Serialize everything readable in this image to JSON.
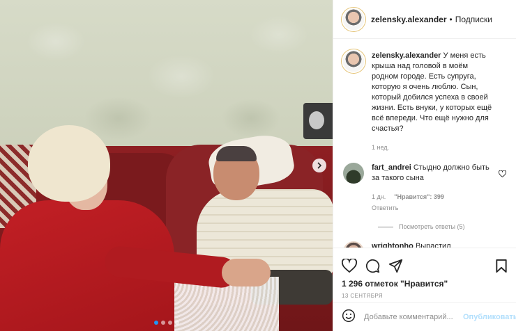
{
  "header": {
    "username": "zelensky.alexander",
    "separator": "•",
    "follow_label": "Подписки"
  },
  "caption": {
    "username": "zelensky.alexander",
    "text": "У меня есть крыша над головой в моём родном городе. Есть супруга, которую я очень люблю. Сын, который добился успеха в своей жизни. Есть внуки, у которых ещё всё впереди. Что ещё нужно для счастья?",
    "time": "1 нед."
  },
  "comments": [
    {
      "username": "fart_andrei",
      "text": "Стыдно должно быть за такого сына",
      "time": "1 дн.",
      "likes": "\"Нравится\": 399",
      "reply_label": "Ответить",
      "view_replies": "Посмотреть ответы (5)"
    },
    {
      "username": "wrightonho",
      "text": "Вырастил наполеончика"
    }
  ],
  "stats": {
    "likes": "1 296 отметок \"Нравится\"",
    "date": "13 СЕНТЯБРЯ"
  },
  "add_comment": {
    "placeholder": "Добавьте комментарий...",
    "publish_label": "Опубликовать"
  },
  "carousel": {
    "total": 4,
    "active": 1
  },
  "icons": [
    "heart-icon",
    "comment-icon",
    "share-icon",
    "bookmark-icon",
    "emoji-icon",
    "chevron-right-icon"
  ],
  "colors": {
    "accent": "#0095f6",
    "publish_disabled": "#b2dffc",
    "secondary_text": "#8e8e8e"
  }
}
